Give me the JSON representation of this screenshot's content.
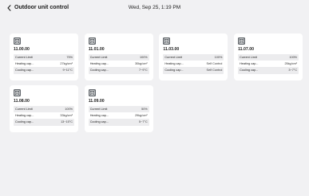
{
  "header": {
    "title": "Outdoor unit control",
    "datetime": "Wed, Sep 25, 1:19 PM"
  },
  "units": [
    {
      "name": "11.00.00",
      "rows": [
        {
          "label": "Current Limit",
          "value": "75%"
        },
        {
          "label": "Heating cap...",
          "value": "27kg/cm²"
        },
        {
          "label": "Cooling cap...",
          "value": "9~11°C"
        }
      ]
    },
    {
      "name": "11.01.00",
      "rows": [
        {
          "label": "Current Limit",
          "value": "100%"
        },
        {
          "label": "Heating cap...",
          "value": "30kg/cm²"
        },
        {
          "label": "Cooling cap...",
          "value": "7~9°C"
        }
      ]
    },
    {
      "name": "11.03.00",
      "rows": [
        {
          "label": "Current Limit",
          "value": "100%"
        },
        {
          "label": "Heating cap...",
          "value": "Self Control"
        },
        {
          "label": "Cooling cap...",
          "value": "Self Control"
        }
      ]
    },
    {
      "name": "11.07.00",
      "rows": [
        {
          "label": "Current Limit",
          "value": "100%"
        },
        {
          "label": "Heating cap...",
          "value": "25kg/cm²"
        },
        {
          "label": "Cooling cap...",
          "value": "3~7°C"
        }
      ]
    },
    {
      "name": "11.08.00",
      "rows": [
        {
          "label": "Current Limit",
          "value": "100%"
        },
        {
          "label": "Heating cap...",
          "value": "33kg/cm²"
        },
        {
          "label": "Cooling cap...",
          "value": "13~15°C"
        }
      ]
    },
    {
      "name": "11.09.00",
      "rows": [
        {
          "label": "Current Limit",
          "value": "50%"
        },
        {
          "label": "Heating cap...",
          "value": "29kg/cm²"
        },
        {
          "label": "Cooling cap...",
          "value": "5~7°C"
        }
      ]
    }
  ]
}
